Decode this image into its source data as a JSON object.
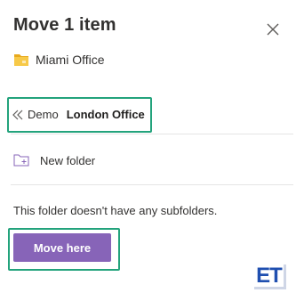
{
  "dialog": {
    "title": "Move 1 item",
    "close_icon": "close-icon"
  },
  "source": {
    "icon": "folder-icon",
    "label": "Miami Office"
  },
  "breadcrumb": {
    "back_icon": "double-chevron-left-icon",
    "parent": "Demo",
    "current": "London Office"
  },
  "actions": {
    "new_folder_icon": "new-folder-icon",
    "new_folder_label": "New folder"
  },
  "empty_message": "This folder doesn't have any subfolders.",
  "move_button_label": "Move here",
  "watermark": {
    "text": "ET"
  },
  "colors": {
    "accent": "#8764b8",
    "highlight": "#23a37c",
    "folder": "#f4c542",
    "logo": "#1f4fb0"
  }
}
